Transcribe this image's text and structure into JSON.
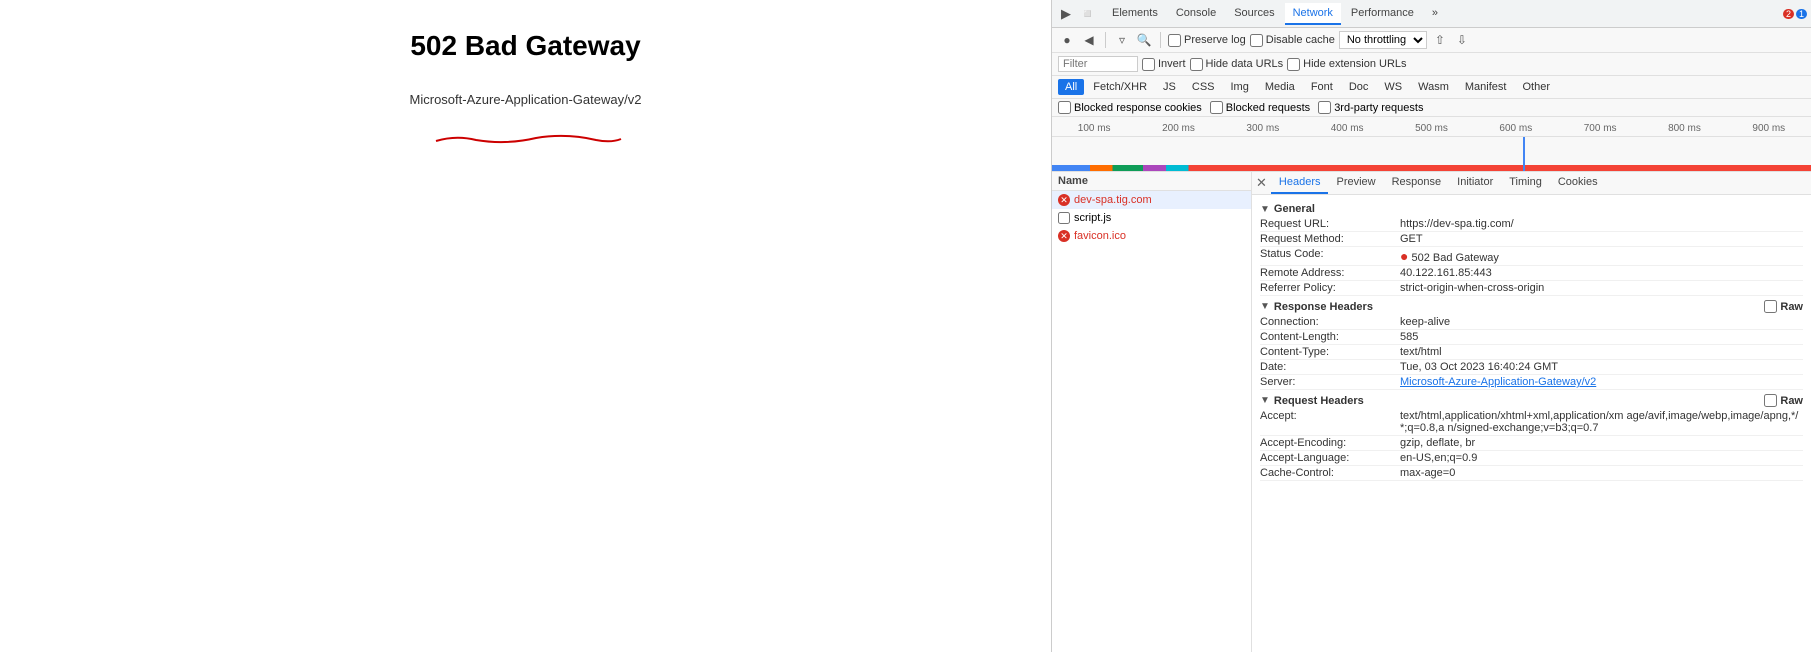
{
  "page": {
    "title": "502 Bad Gateway",
    "subtitle": "Microsoft-Azure-Application-Gateway/v2"
  },
  "devtools": {
    "tabs": [
      {
        "label": "Elements",
        "active": false
      },
      {
        "label": "Console",
        "active": false
      },
      {
        "label": "Sources",
        "active": false
      },
      {
        "label": "Network",
        "active": true
      },
      {
        "label": "Performance",
        "active": false
      },
      {
        "label": "»",
        "active": false
      }
    ],
    "badges": {
      "error_count": "2",
      "warning_count": "1"
    },
    "toolbar": {
      "preserve_log_label": "Preserve log",
      "disable_cache_label": "Disable cache",
      "throttling_label": "No throttling",
      "filter_placeholder": "Filter",
      "invert_label": "Invert",
      "hide_data_urls_label": "Hide data URLs",
      "hide_extension_urls_label": "Hide extension URLs"
    },
    "filter_pills": [
      "All",
      "Fetch/XHR",
      "JS",
      "CSS",
      "Img",
      "Media",
      "Font",
      "Doc",
      "WS",
      "Wasm",
      "Manifest",
      "Other"
    ],
    "active_pill": "All",
    "filter_checkboxes": [
      "Blocked response cookies",
      "Blocked requests",
      "3rd-party requests"
    ],
    "timeline_labels": [
      "100 ms",
      "200 ms",
      "300 ms",
      "400 ms",
      "500 ms",
      "600 ms",
      "700 ms",
      "800 ms",
      "900 ms"
    ],
    "requests": [
      {
        "name": "dev-spa.tig.com",
        "type": "error",
        "selected": true,
        "has_checkbox": false
      },
      {
        "name": "script.js",
        "type": "normal",
        "selected": false,
        "has_checkbox": true
      },
      {
        "name": "favicon.ico",
        "type": "error",
        "selected": false,
        "has_checkbox": false
      }
    ],
    "detail_tabs": [
      "Headers",
      "Preview",
      "Response",
      "Initiator",
      "Timing",
      "Cookies"
    ],
    "active_detail_tab": "Headers",
    "headers": {
      "general": {
        "title": "General",
        "rows": [
          {
            "key": "Request URL:",
            "value": "https://dev-spa.tig.com/",
            "link": false
          },
          {
            "key": "Request Method:",
            "value": "GET",
            "link": false
          },
          {
            "key": "Status Code:",
            "value": "502 Bad Gateway",
            "link": false,
            "has_dot": true
          },
          {
            "key": "Remote Address:",
            "value": "40.122.161.85:443",
            "link": false
          },
          {
            "key": "Referrer Policy:",
            "value": "strict-origin-when-cross-origin",
            "link": false
          }
        ]
      },
      "response_headers": {
        "title": "Response Headers",
        "raw_label": "Raw",
        "rows": [
          {
            "key": "Connection:",
            "value": "keep-alive",
            "link": false
          },
          {
            "key": "Content-Length:",
            "value": "585",
            "link": false
          },
          {
            "key": "Content-Type:",
            "value": "text/html",
            "link": false
          },
          {
            "key": "Date:",
            "value": "Tue, 03 Oct 2023 16:40:24 GMT",
            "link": false
          },
          {
            "key": "Server:",
            "value": "Microsoft-Azure-Application-Gateway/v2",
            "link": true
          }
        ]
      },
      "request_headers": {
        "title": "Request Headers",
        "raw_label": "Raw",
        "rows": [
          {
            "key": "Accept:",
            "value": "text/html,application/xhtml+xml,application/xm age/avif,image/webp,image/apng,*/*;q=0.8,a n/signed-exchange;v=b3;q=0.7",
            "link": false
          },
          {
            "key": "Accept-Encoding:",
            "value": "gzip, deflate, br",
            "link": false
          },
          {
            "key": "Accept-Language:",
            "value": "en-US,en;q=0.9",
            "link": false
          },
          {
            "key": "Cache-Control:",
            "value": "max-age=0",
            "link": false
          }
        ]
      }
    }
  }
}
